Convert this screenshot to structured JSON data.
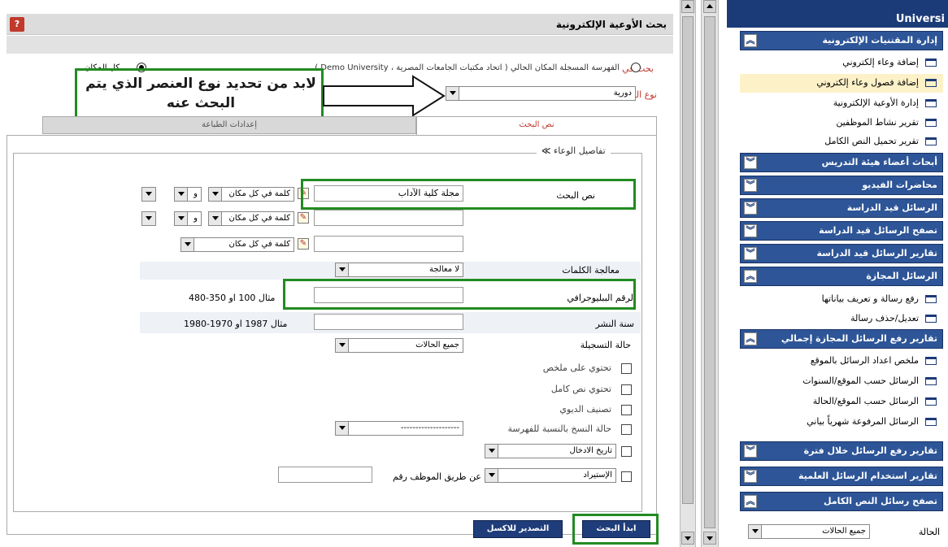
{
  "main": {
    "title": "بحث الأوعية الإلكترونية",
    "help_icon": "help-icon",
    "search_in_label": "بحث في",
    "scope_options": {
      "current": "الفهرسة المسجلة المكان الحالي ( اتحاد مكتبات الجامعات المصرية ، Demo University )",
      "all": "كل المكان"
    },
    "item_type_label": "نوع العنصر",
    "item_type_value": "دورية",
    "callout_text": "لابد من تحديد نوع العنصر الذي يتم البحث عنه",
    "tabs": {
      "search": "نص البحث",
      "settings": "إعدادات الطباعة"
    },
    "details_legend": "تفاصيل الوعاء",
    "search_text_label": "نص البحث",
    "search_rows": [
      {
        "value": "مجلة كلية الآداب",
        "match": "كلمة في كل مكان",
        "op": "و"
      },
      {
        "value": "",
        "match": "كلمة في كل مكان",
        "op": "و"
      },
      {
        "value": "",
        "match": "كلمة في كل مكان"
      }
    ],
    "word_processing_label": "معالجة الكلمات",
    "word_processing_value": "لا معالجة",
    "biblio_number_label": "الرقم الببليوجرافي",
    "biblio_number_example": "مثال 100 او 350-480",
    "pub_year_label": "سنة النشر",
    "pub_year_example": "مثال 1987 او 1970-1980",
    "reg_status_label": "حالة التسجيلة",
    "reg_status_value": "جميع الحالات",
    "checkboxes": {
      "has_abstract": "تحتوي على ملخص",
      "has_fulltext": "تحتوي نص كامل",
      "dewey": "تصنيف الديوي",
      "copy_status": "حالة النسخ بالنسبة للفهرسة"
    },
    "copy_status_value": "--------------------",
    "entry_date_value": "تاريخ الادخال",
    "import_value": "الإستيراد",
    "employee_label": "عن طريق الموظف رقم",
    "buttons": {
      "start_search": "ابدأ البحث",
      "export_all": "التصدير للاكسل"
    }
  },
  "sidebar": {
    "brand": "Universi",
    "sections": [
      {
        "title": "إدارة المقتنيات الإلكترونية",
        "expanded": true
      },
      {
        "title": "أبحاث أعضاء هيئة التدريس",
        "expanded": false
      },
      {
        "title": "محاضرات الفيديو",
        "expanded": false
      },
      {
        "title": "الرسائل قيد الدراسة",
        "expanded": false
      },
      {
        "title": "تصفح الرسائل قيد الدراسة",
        "expanded": false
      },
      {
        "title": "تقارير الرسائل قيد الدراسة",
        "expanded": false
      },
      {
        "title": "الرسائل المجازة",
        "expanded": true
      },
      {
        "title": "تقارير رفع الرسائل المجازة إجمالي",
        "expanded": true
      },
      {
        "title": "تقارير رفع الرسائل خلال فترة",
        "expanded": false
      },
      {
        "title": "تقارير استخدام الرسائل العلمية",
        "expanded": false
      },
      {
        "title": "تصفح رسائل النص الكامل",
        "expanded": true
      }
    ],
    "items_electronic": [
      "إضافة وعاء إلكتروني",
      "إضافة فصول وعاء إلكتروني",
      "إدارة الأوعية الإلكترونية",
      "تقرير نشاط الموظفين",
      "تقرير تحميل النص الكامل"
    ],
    "items_approved": [
      "رفع رسالة و تعريف بياناتها",
      "تعديل/حذف رسالة"
    ],
    "items_reports": [
      "ملخص اعداد الرسائل بالموقع",
      "الرسائل حسب الموقع/السنوات",
      "الرسائل حسب الموقع/الحالة",
      "الرسائل المرفوعة شهرياً بياني"
    ],
    "status_label": "الحالة",
    "status_value": "جميع الحالات"
  },
  "colors": {
    "accent_green": "#228b22",
    "nav_blue": "#2d5597",
    "brand_blue": "#1b3a78"
  }
}
